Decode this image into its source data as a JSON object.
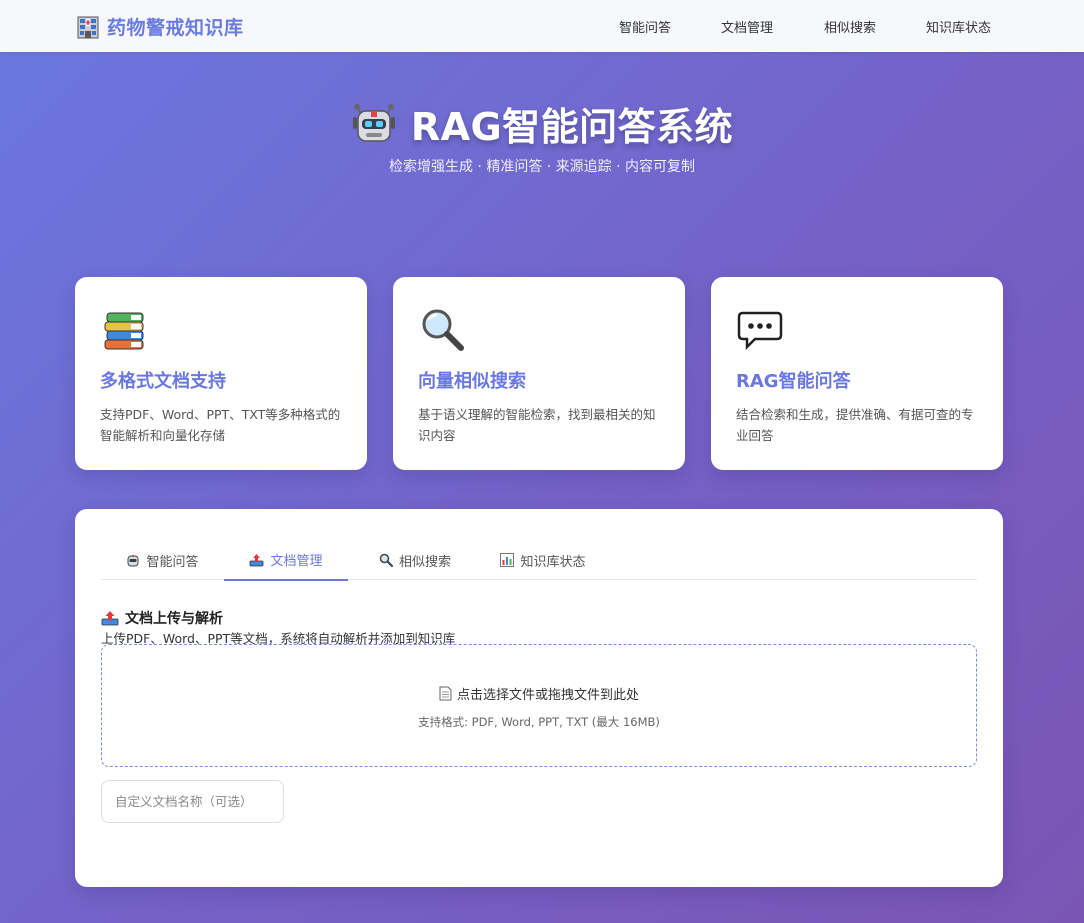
{
  "nav": {
    "brand_title": "药物警戒知识库",
    "brand_icon": "hospital-icon",
    "links": [
      "智能问答",
      "文档管理",
      "相似搜索",
      "知识库状态"
    ]
  },
  "hero": {
    "icon": "robot-icon",
    "title": "RAG智能问答系统",
    "subtitle": "检索增强生成 · 精准问答 · 来源追踪 · 内容可复制"
  },
  "features": [
    {
      "icon": "books-icon",
      "title": "多格式文档支持",
      "desc": "支持PDF、Word、PPT、TXT等多种格式的智能解析和向量化存储"
    },
    {
      "icon": "magnifier-icon",
      "title": "向量相似搜索",
      "desc": "基于语义理解的智能检索，找到最相关的知识内容"
    },
    {
      "icon": "speech-bubble-icon",
      "title": "RAG智能问答",
      "desc": "结合检索和生成，提供准确、有据可查的专业回答"
    }
  ],
  "tabs": [
    {
      "icon": "robot-icon",
      "label": "智能问答"
    },
    {
      "icon": "upload-tray-icon",
      "label": "文档管理",
      "active": true
    },
    {
      "icon": "magnifier-icon",
      "label": "相似搜索"
    },
    {
      "icon": "bar-chart-icon",
      "label": "知识库状态"
    }
  ],
  "upload": {
    "icon": "upload-tray-icon",
    "title": "文档上传与解析",
    "subtitle": "上传PDF、Word、PPT等文档，系统将自动解析并添加到知识库",
    "dropzone_icon": "document-icon",
    "dropzone_text": "点击选择文件或拖拽文件到此处",
    "dropzone_hint": "支持格式: PDF, Word, PPT, TXT (最大 16MB)",
    "name_placeholder": "自定义文档名称（可选）"
  },
  "colors": {
    "accent": "#6a78e0",
    "bg_start": "#6a78e0",
    "bg_end": "#7a55b4"
  }
}
